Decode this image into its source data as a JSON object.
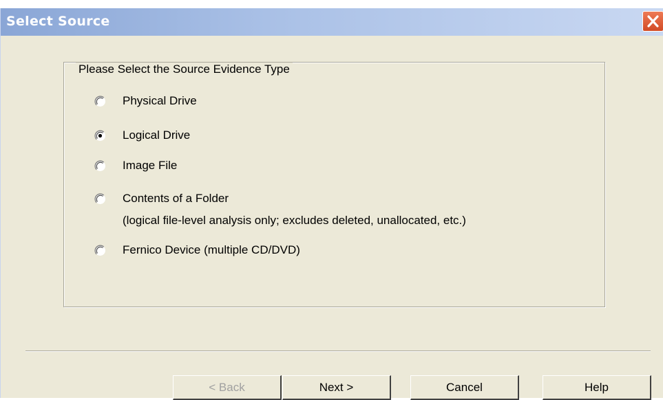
{
  "window": {
    "title": "Select Source",
    "close_icon": "close-x-icon"
  },
  "group": {
    "legend": "Please Select the Source Evidence Type",
    "options": [
      {
        "label": "Physical Drive",
        "selected": false
      },
      {
        "label": "Logical Drive",
        "selected": true
      },
      {
        "label": "Image File",
        "selected": false
      },
      {
        "label": "Contents of a Folder",
        "note": "(logical file-level analysis only; excludes deleted, unallocated, etc.)",
        "selected": false
      },
      {
        "label": "Fernico Device (multiple CD/DVD)",
        "selected": false
      }
    ]
  },
  "buttons": {
    "back": "< Back",
    "back_disabled": true,
    "next": "Next >",
    "cancel": "Cancel",
    "help": "Help"
  },
  "colors": {
    "dialog_bg": "#ece9d8",
    "title_bar": "#a9c0e6",
    "close_button": "#d24b26"
  }
}
